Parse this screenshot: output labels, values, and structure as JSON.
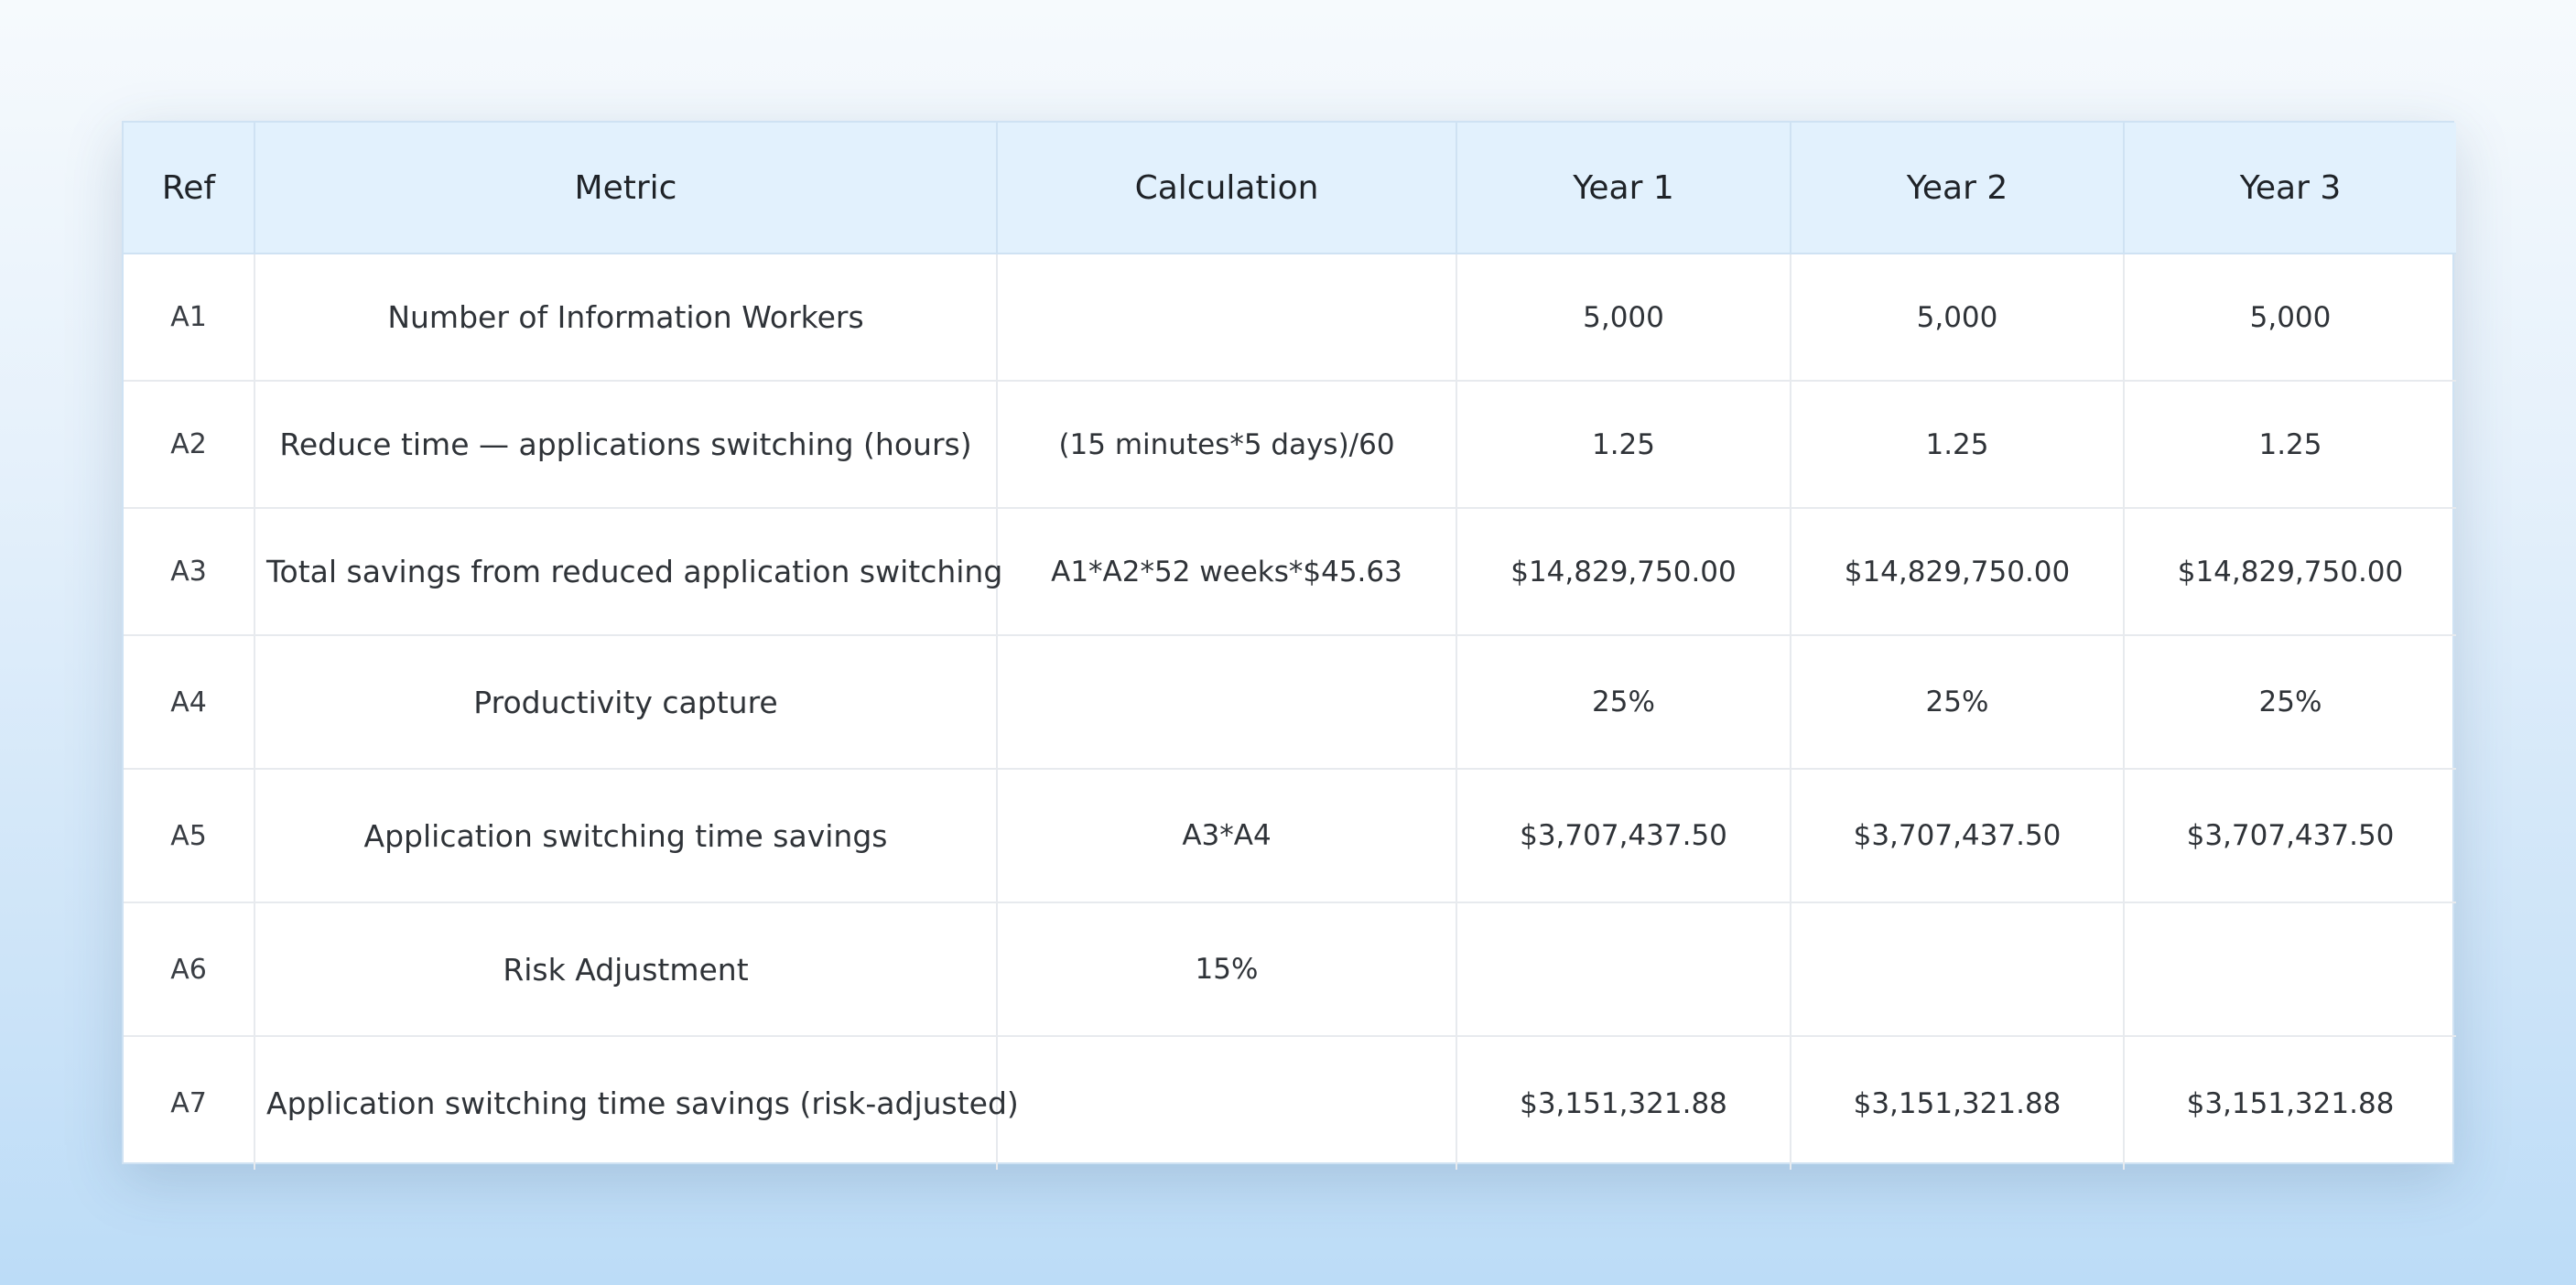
{
  "table": {
    "headers": {
      "ref": "Ref",
      "metric": "Metric",
      "calculation": "Calculation",
      "year1": "Year 1",
      "year2": "Year 2",
      "year3": "Year 3"
    },
    "rows": [
      {
        "ref": "A1",
        "metric": "Number of Information Workers",
        "calculation": "",
        "year1": "5,000",
        "year2": "5,000",
        "year3": "5,000"
      },
      {
        "ref": "A2",
        "metric": "Reduce time — applications switching (hours)",
        "calculation": "(15 minutes*5 days)/60",
        "year1": "1.25",
        "year2": "1.25",
        "year3": "1.25"
      },
      {
        "ref": "A3",
        "metric": "Total savings from reduced application switching",
        "calculation": "A1*A2*52 weeks*$45.63",
        "year1": "$14,829,750.00",
        "year2": "$14,829,750.00",
        "year3": "$14,829,750.00"
      },
      {
        "ref": "A4",
        "metric": "Productivity capture",
        "calculation": "",
        "year1": "25%",
        "year2": "25%",
        "year3": "25%"
      },
      {
        "ref": "A5",
        "metric": "Application switching time savings",
        "calculation": "A3*A4",
        "year1": "$3,707,437.50",
        "year2": "$3,707,437.50",
        "year3": "$3,707,437.50"
      },
      {
        "ref": "A6",
        "metric": "Risk Adjustment",
        "calculation": "15%",
        "year1": "",
        "year2": "",
        "year3": ""
      },
      {
        "ref": "A7",
        "metric": "Application switching time savings (risk-adjusted)",
        "calculation": "",
        "year1": "$3,151,321.88",
        "year2": "$3,151,321.88",
        "year3": "$3,151,321.88"
      }
    ]
  }
}
